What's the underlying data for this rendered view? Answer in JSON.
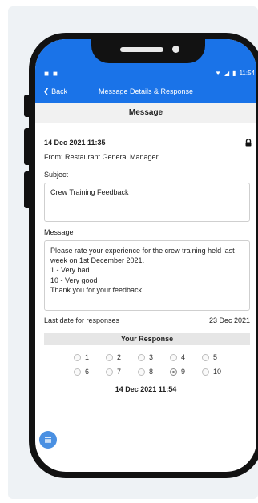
{
  "status_bar": {
    "left_icons": "■ ■",
    "time": "11:54"
  },
  "nav": {
    "back_label": "Back",
    "title": "Message Details & Response"
  },
  "section_title": "Message",
  "message": {
    "datetime": "14 Dec 2021   11:35",
    "from": "From: Restaurant General Manager",
    "subject_label": "Subject",
    "subject": "Crew Training Feedback",
    "message_label": "Message",
    "body_lines": [
      "Please rate your experience for the crew training held last",
      "week on 1st December 2021.",
      "1 - Very bad",
      "10 - Very good",
      "Thank you for your feedback!"
    ],
    "last_date_label": "Last date for responses",
    "last_date_value": "23 Dec 2021"
  },
  "response": {
    "header": "Your Response",
    "options": [
      "1",
      "2",
      "3",
      "4",
      "5",
      "6",
      "7",
      "8",
      "9",
      "10"
    ],
    "selected": "9",
    "timestamp": "14 Dec 2021   11:54"
  },
  "icons": {
    "lock": "lock-icon",
    "fab": "menu-icon",
    "back": "chevron-left-icon"
  }
}
